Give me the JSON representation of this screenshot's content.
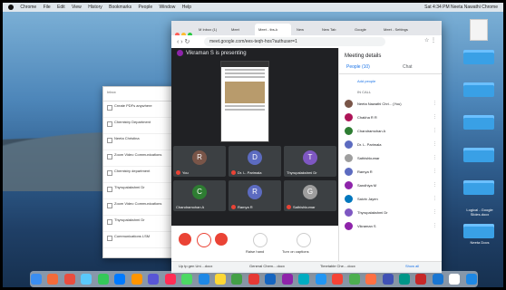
{
  "menubar": {
    "items": [
      "Chrome",
      "File",
      "Edit",
      "View",
      "History",
      "Bookmarks",
      "People",
      "Window",
      "Help"
    ],
    "right": "Sat 4:34 PM  Neeta Nawathi Chrome"
  },
  "desktop": {
    "labels": [
      "Logical - Google Slides.docx",
      "Neeta Docs"
    ]
  },
  "bg_window": {
    "title": "Inbox",
    "items": [
      "Create PDFs anywhere",
      "Chemistry Department",
      "Neeta Christina",
      "Zoom Video Communications",
      "Chemistry department",
      "Thyrupalakshmi Dr",
      "Zoom Video Communications",
      "Thyrupalakshmi Dr",
      "Communications LSM"
    ]
  },
  "chrome": {
    "tabs": [
      "M Inbox (1)",
      "Meet",
      "Meet - tbs-k",
      "New",
      "New Tab",
      "Google",
      "Meet - Settings"
    ],
    "url": "meet.google.com/ees-teqh-hos?authuser=1",
    "presenting": "Vikraman S is presenting"
  },
  "tiles": [
    {
      "initial": "R",
      "name": "You",
      "color": "#795548"
    },
    {
      "initial": "D",
      "name": "Dr. L. Parimala",
      "color": "#5c6bc0"
    },
    {
      "initial": "T",
      "name": "Thyrupalakshmi Dr",
      "color": "#7e57c2"
    },
    {
      "initial": "C",
      "name": "Chandramohan A",
      "color": "#2e7d32"
    },
    {
      "initial": "R",
      "name": "Ramya R",
      "color": "#5c6bc0"
    },
    {
      "initial": "G",
      "name": "Sathishkumar",
      "color": "#9e9e9e"
    }
  ],
  "controls": {
    "raise": "Raise hand",
    "captions": "Turn on captions"
  },
  "panel": {
    "title": "Meeting details",
    "tab_people": "People (10)",
    "tab_chat": "Chat",
    "add": "Add people",
    "section": "IN CALL",
    "people": [
      {
        "name": "Neeta Nawathi Chri... (You)",
        "color": "#795548"
      },
      {
        "name": "Chakha R R",
        "color": "#ad1457"
      },
      {
        "name": "Chandramohan A",
        "color": "#2e7d32"
      },
      {
        "name": "Dr. L. Parimala",
        "color": "#5c6bc0"
      },
      {
        "name": "Sathishkumar",
        "color": "#9e9e9e"
      },
      {
        "name": "Ramya R",
        "color": "#5c6bc0"
      },
      {
        "name": "Sandhiya M",
        "color": "#8e24aa"
      },
      {
        "name": "Saivin Jayen",
        "color": "#0277bd"
      },
      {
        "name": "Thyrupalakshmi Dr",
        "color": "#7e57c2"
      },
      {
        "name": "Vikraman S",
        "color": "#8e24aa"
      }
    ]
  },
  "downloads": [
    "Up tp gen Uni....docx",
    "General Chem....docx",
    "Timetable Che....docx"
  ],
  "show_all": "Show all"
}
